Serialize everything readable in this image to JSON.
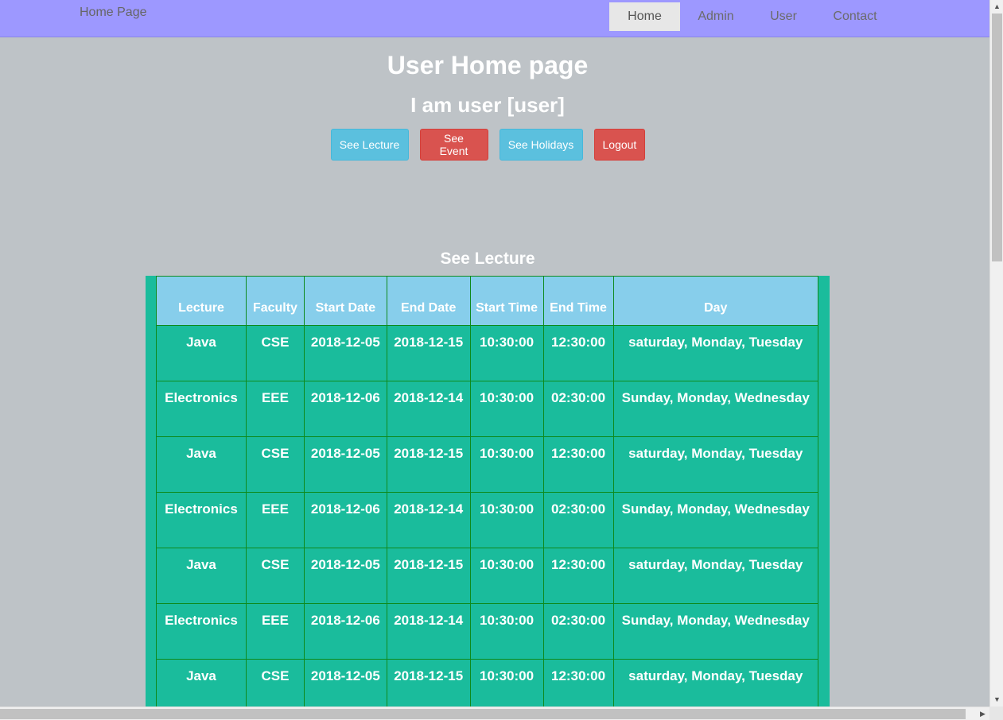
{
  "navbar": {
    "brand": "Home Page",
    "items": [
      {
        "label": "Home",
        "active": true
      },
      {
        "label": "Admin"
      },
      {
        "label": "User"
      },
      {
        "label": "Contact"
      }
    ]
  },
  "header": {
    "title": "User Home page",
    "subtitle": "I am user [user]"
  },
  "actions": [
    {
      "label": "See Lecture",
      "style": "info"
    },
    {
      "label": "See Event",
      "style": "danger"
    },
    {
      "label": "See Holidays",
      "style": "info"
    },
    {
      "label": "Logout",
      "style": "danger"
    }
  ],
  "section_title": "See Lecture",
  "table": {
    "columns": [
      "Lecture",
      "Faculty",
      "Start Date",
      "End Date",
      "Start Time",
      "End Time",
      "Day"
    ],
    "rows": [
      [
        "Java",
        "CSE",
        "2018-12-05",
        "2018-12-15",
        "10:30:00",
        "12:30:00",
        "saturday, Monday, Tuesday"
      ],
      [
        "Electronics",
        "EEE",
        "2018-12-06",
        "2018-12-14",
        "10:30:00",
        "02:30:00",
        "Sunday, Monday, Wednesday"
      ],
      [
        "Java",
        "CSE",
        "2018-12-05",
        "2018-12-15",
        "10:30:00",
        "12:30:00",
        "saturday, Monday, Tuesday"
      ],
      [
        "Electronics",
        "EEE",
        "2018-12-06",
        "2018-12-14",
        "10:30:00",
        "02:30:00",
        "Sunday, Monday, Wednesday"
      ],
      [
        "Java",
        "CSE",
        "2018-12-05",
        "2018-12-15",
        "10:30:00",
        "12:30:00",
        "saturday, Monday, Tuesday"
      ],
      [
        "Electronics",
        "EEE",
        "2018-12-06",
        "2018-12-14",
        "10:30:00",
        "02:30:00",
        "Sunday, Monday, Wednesday"
      ],
      [
        "Java",
        "CSE",
        "2018-12-05",
        "2018-12-15",
        "10:30:00",
        "12:30:00",
        "saturday, Monday, Tuesday"
      ]
    ]
  },
  "colors": {
    "navbar": "#9d98ff",
    "page_bg": "#bec3c7",
    "table_bg": "#1abc9c",
    "header_bg": "#87ceeb",
    "info": "#5bc0de",
    "danger": "#d9534f"
  }
}
